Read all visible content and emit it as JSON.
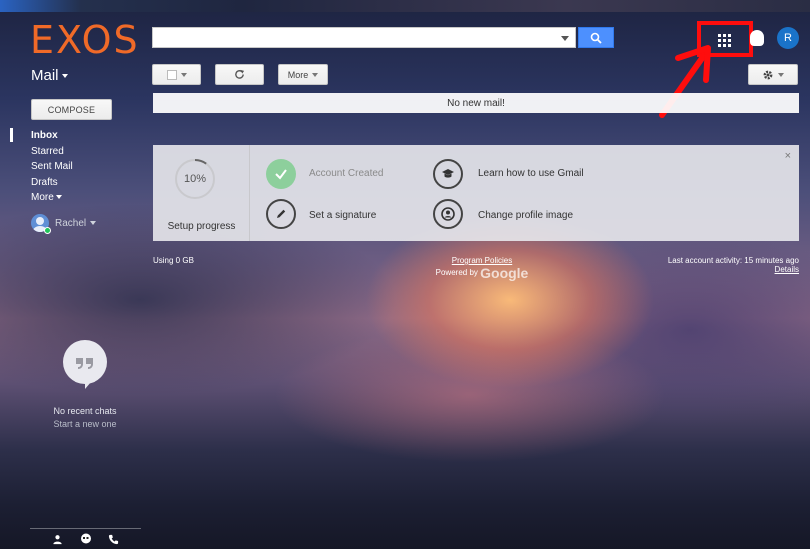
{
  "app": {
    "logo": "EXOS"
  },
  "search": {
    "value": "",
    "placeholder": ""
  },
  "header": {
    "avatar_initial": "R"
  },
  "mail_menu": {
    "label": "Mail"
  },
  "toolbar": {
    "more_label": "More"
  },
  "notice": {
    "no_mail": "No new mail!"
  },
  "compose": {
    "label": "COMPOSE"
  },
  "nav": {
    "items": [
      {
        "label": "Inbox",
        "active": true
      },
      {
        "label": "Starred"
      },
      {
        "label": "Sent Mail"
      },
      {
        "label": "Drafts"
      },
      {
        "label": "More"
      }
    ]
  },
  "user": {
    "name": "Rachel"
  },
  "setup": {
    "progress_text": "10%",
    "progress_value": 0.1,
    "label": "Setup progress",
    "steps": [
      {
        "label": "Account Created",
        "done": true
      },
      {
        "label": "Learn how to use Gmail",
        "done": false
      },
      {
        "label": "Set a signature",
        "done": false
      },
      {
        "label": "Change profile image",
        "done": false
      }
    ],
    "close_symbol": "×"
  },
  "footer": {
    "storage": "Using 0 GB",
    "policies": "Program Policies",
    "powered_by": "Powered by",
    "google": "Google",
    "last_activity": "Last account activity: 15 minutes ago",
    "details": "Details"
  },
  "chat": {
    "status": "No recent chats",
    "start": "Start a new one"
  },
  "colors": {
    "logo": "#f06a28",
    "search_button": "#4d90fe",
    "highlight_red": "#ff0d0d",
    "avatar_blue": "#1a73c9",
    "done_green": "#8dcf9c"
  }
}
